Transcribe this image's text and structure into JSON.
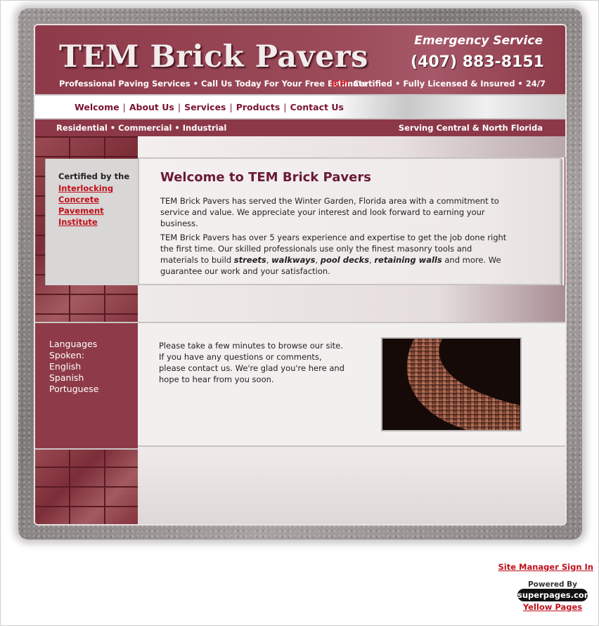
{
  "header": {
    "brand": "TEM Brick Pavers",
    "tagline": "Professional Paving Services • Call Us Today For Your Free Estimate",
    "emergency": "Emergency Service",
    "phone": "(407) 883-8151",
    "icpi_mark": "ICPI",
    "cert_line": "Certified • Fully Licensed & Insured • 24/7"
  },
  "nav": {
    "items": [
      {
        "label": "Welcome"
      },
      {
        "label": "About Us"
      },
      {
        "label": "Services"
      },
      {
        "label": "Products"
      },
      {
        "label": "Contact Us"
      }
    ],
    "separator": "|"
  },
  "subbar": {
    "left": "Residential • Commercial • Industrial",
    "right": "Serving Central & North Florida"
  },
  "sidebar": {
    "certified_by": "Certified by the",
    "icpi_link": "Interlocking Concrete Pavement Institute",
    "languages": [
      "Languages Spoken:",
      "English",
      "Spanish",
      "Portuguese"
    ]
  },
  "main": {
    "title": "Welcome to TEM Brick Pavers",
    "p1": "TEM Brick Pavers has served the Winter Garden, Florida area with a commitment to service and value. We appreciate your interest and look forward to earning your business.",
    "p2_start": "TEM Brick Pavers has over 5 years experience and expertise to get the job done right the first time. Our skilled professionals use only the finest masonry tools and materials to build ",
    "p2_items": [
      "streets",
      "walkways",
      "pool decks",
      "retaining walls"
    ],
    "p2_end": " and more. We guarantee our work and your satisfaction.",
    "browse": "Please take a few minutes to browse our site. If you have any questions or comments, please contact us. We're glad you're here and hope to hear from you soon."
  },
  "footer": {
    "site_manager": "Site Manager Sign In",
    "powered_by": "Powered By",
    "logo_text": "superpages.com",
    "yellow_pages": "Yellow Pages"
  },
  "colors": {
    "maroon": "#8e3a48",
    "nav_text": "#7a1430",
    "link_red": "#c0101a",
    "title": "#6a1a38"
  }
}
